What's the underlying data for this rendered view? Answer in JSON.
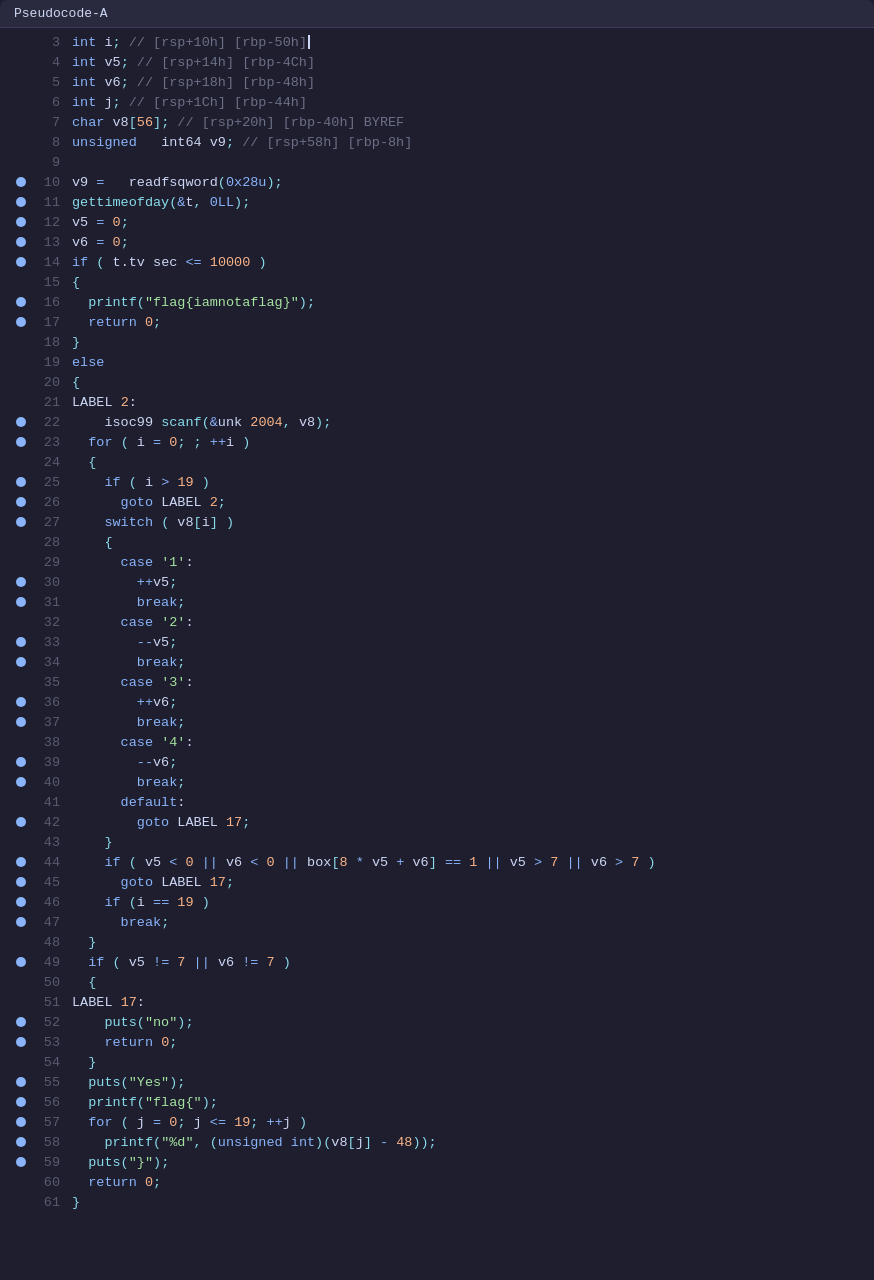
{
  "title": "Pseudocode-A",
  "lines": [
    {
      "ln": 3,
      "dot": false,
      "content": "int_i;_//_[rsp+10h]_[rbp-50h]_|cursor|"
    },
    {
      "ln": 4,
      "dot": false,
      "content": "int_v5;_//_[rsp+14h]_[rbp-4Ch]"
    },
    {
      "ln": 5,
      "dot": false,
      "content": "int_v6;_//_[rsp+18h]_[rbp-48h]"
    },
    {
      "ln": 6,
      "dot": false,
      "content": "int_j;_//_[rsp+1Ch]_[rbp-44h]"
    },
    {
      "ln": 7,
      "dot": false,
      "content": "char_v8[56];_//_[rsp+20h]_[rbp-40h]_BYREF"
    },
    {
      "ln": 8,
      "dot": false,
      "content": "unsigned___int64_v9;_//_[rsp+58h]_[rbp-8h]"
    },
    {
      "ln": 9,
      "dot": false,
      "content": ""
    },
    {
      "ln": 10,
      "dot": true,
      "content": "v9_=___readfsqword(0x28u);"
    },
    {
      "ln": 11,
      "dot": true,
      "content": "gettimeofday(&t,_0LL);"
    },
    {
      "ln": 12,
      "dot": true,
      "content": "v5_=_0;"
    },
    {
      "ln": 13,
      "dot": true,
      "content": "v6_=_0;"
    },
    {
      "ln": 14,
      "dot": true,
      "content": "if_(_t.tv_sec_<=_10000_)"
    },
    {
      "ln": 15,
      "dot": false,
      "content": "{"
    },
    {
      "ln": 16,
      "dot": true,
      "content": "  printf(\"flag{iamnotaflag}\");"
    },
    {
      "ln": 17,
      "dot": true,
      "content": "  return_0;"
    },
    {
      "ln": 18,
      "dot": false,
      "content": "}"
    },
    {
      "ln": 19,
      "dot": false,
      "content": "else"
    },
    {
      "ln": 20,
      "dot": false,
      "content": "{"
    },
    {
      "ln": 21,
      "dot": false,
      "content": "LABEL_2:"
    },
    {
      "ln": 22,
      "dot": true,
      "content": "  __isoc99_scanf(&unk_2004,_v8);"
    },
    {
      "ln": 23,
      "dot": true,
      "content": "  for_(_i_=_0;_;_++i_)"
    },
    {
      "ln": 24,
      "dot": false,
      "content": "  {"
    },
    {
      "ln": 25,
      "dot": true,
      "content": "    if_(_i_>_19_)"
    },
    {
      "ln": 26,
      "dot": true,
      "content": "      goto_LABEL_2;"
    },
    {
      "ln": 27,
      "dot": true,
      "content": "    switch_(_v8[i]_)"
    },
    {
      "ln": 28,
      "dot": false,
      "content": "    {"
    },
    {
      "ln": 29,
      "dot": false,
      "content": "      case_'1':"
    },
    {
      "ln": 30,
      "dot": true,
      "content": "        ++v5;"
    },
    {
      "ln": 31,
      "dot": true,
      "content": "        break;"
    },
    {
      "ln": 32,
      "dot": false,
      "content": "      case_'2':"
    },
    {
      "ln": 33,
      "dot": true,
      "content": "        --v5;"
    },
    {
      "ln": 34,
      "dot": true,
      "content": "        break;"
    },
    {
      "ln": 35,
      "dot": false,
      "content": "      case_'3':"
    },
    {
      "ln": 36,
      "dot": true,
      "content": "        ++v6;"
    },
    {
      "ln": 37,
      "dot": true,
      "content": "        break;"
    },
    {
      "ln": 38,
      "dot": false,
      "content": "      case_'4':"
    },
    {
      "ln": 39,
      "dot": true,
      "content": "        --v6;"
    },
    {
      "ln": 40,
      "dot": true,
      "content": "        break;"
    },
    {
      "ln": 41,
      "dot": false,
      "content": "      default:"
    },
    {
      "ln": 42,
      "dot": true,
      "content": "        goto_LABEL_17;"
    },
    {
      "ln": 43,
      "dot": false,
      "content": "    }"
    },
    {
      "ln": 44,
      "dot": true,
      "content": "    if_(_v5_<_0_||_v6_<_0_||_box[8_*_v5_+_v6]_==_1_||_v5_>_7_||_v6_>_7_)"
    },
    {
      "ln": 45,
      "dot": true,
      "content": "      goto_LABEL_17;"
    },
    {
      "ln": 46,
      "dot": true,
      "content": "    if_(i_==_19_)"
    },
    {
      "ln": 47,
      "dot": true,
      "content": "      break;"
    },
    {
      "ln": 48,
      "dot": false,
      "content": "  }"
    },
    {
      "ln": 49,
      "dot": true,
      "content": "  if_(_v5_!=_7_||_v6_!=_7_)"
    },
    {
      "ln": 50,
      "dot": false,
      "content": "  {"
    },
    {
      "ln": 51,
      "dot": false,
      "content": "LABEL_17:"
    },
    {
      "ln": 52,
      "dot": true,
      "content": "    puts(\"no\");"
    },
    {
      "ln": 53,
      "dot": true,
      "content": "    return_0;"
    },
    {
      "ln": 54,
      "dot": false,
      "content": "  }"
    },
    {
      "ln": 55,
      "dot": true,
      "content": "  puts(\"Yes\");"
    },
    {
      "ln": 56,
      "dot": true,
      "content": "  printf(\"flag{\");"
    },
    {
      "ln": 57,
      "dot": true,
      "content": "  for_(_j_=_0;_j_<=_19;_++j_)"
    },
    {
      "ln": 58,
      "dot": true,
      "content": "    printf(\"%d\",_(unsigned_int)(v8[j]_-_48));"
    },
    {
      "ln": 59,
      "dot": true,
      "content": "  puts(\"}\");"
    },
    {
      "ln": 60,
      "dot": false,
      "content": "  return_0;"
    },
    {
      "ln": 61,
      "dot": false,
      "content": "}"
    }
  ]
}
